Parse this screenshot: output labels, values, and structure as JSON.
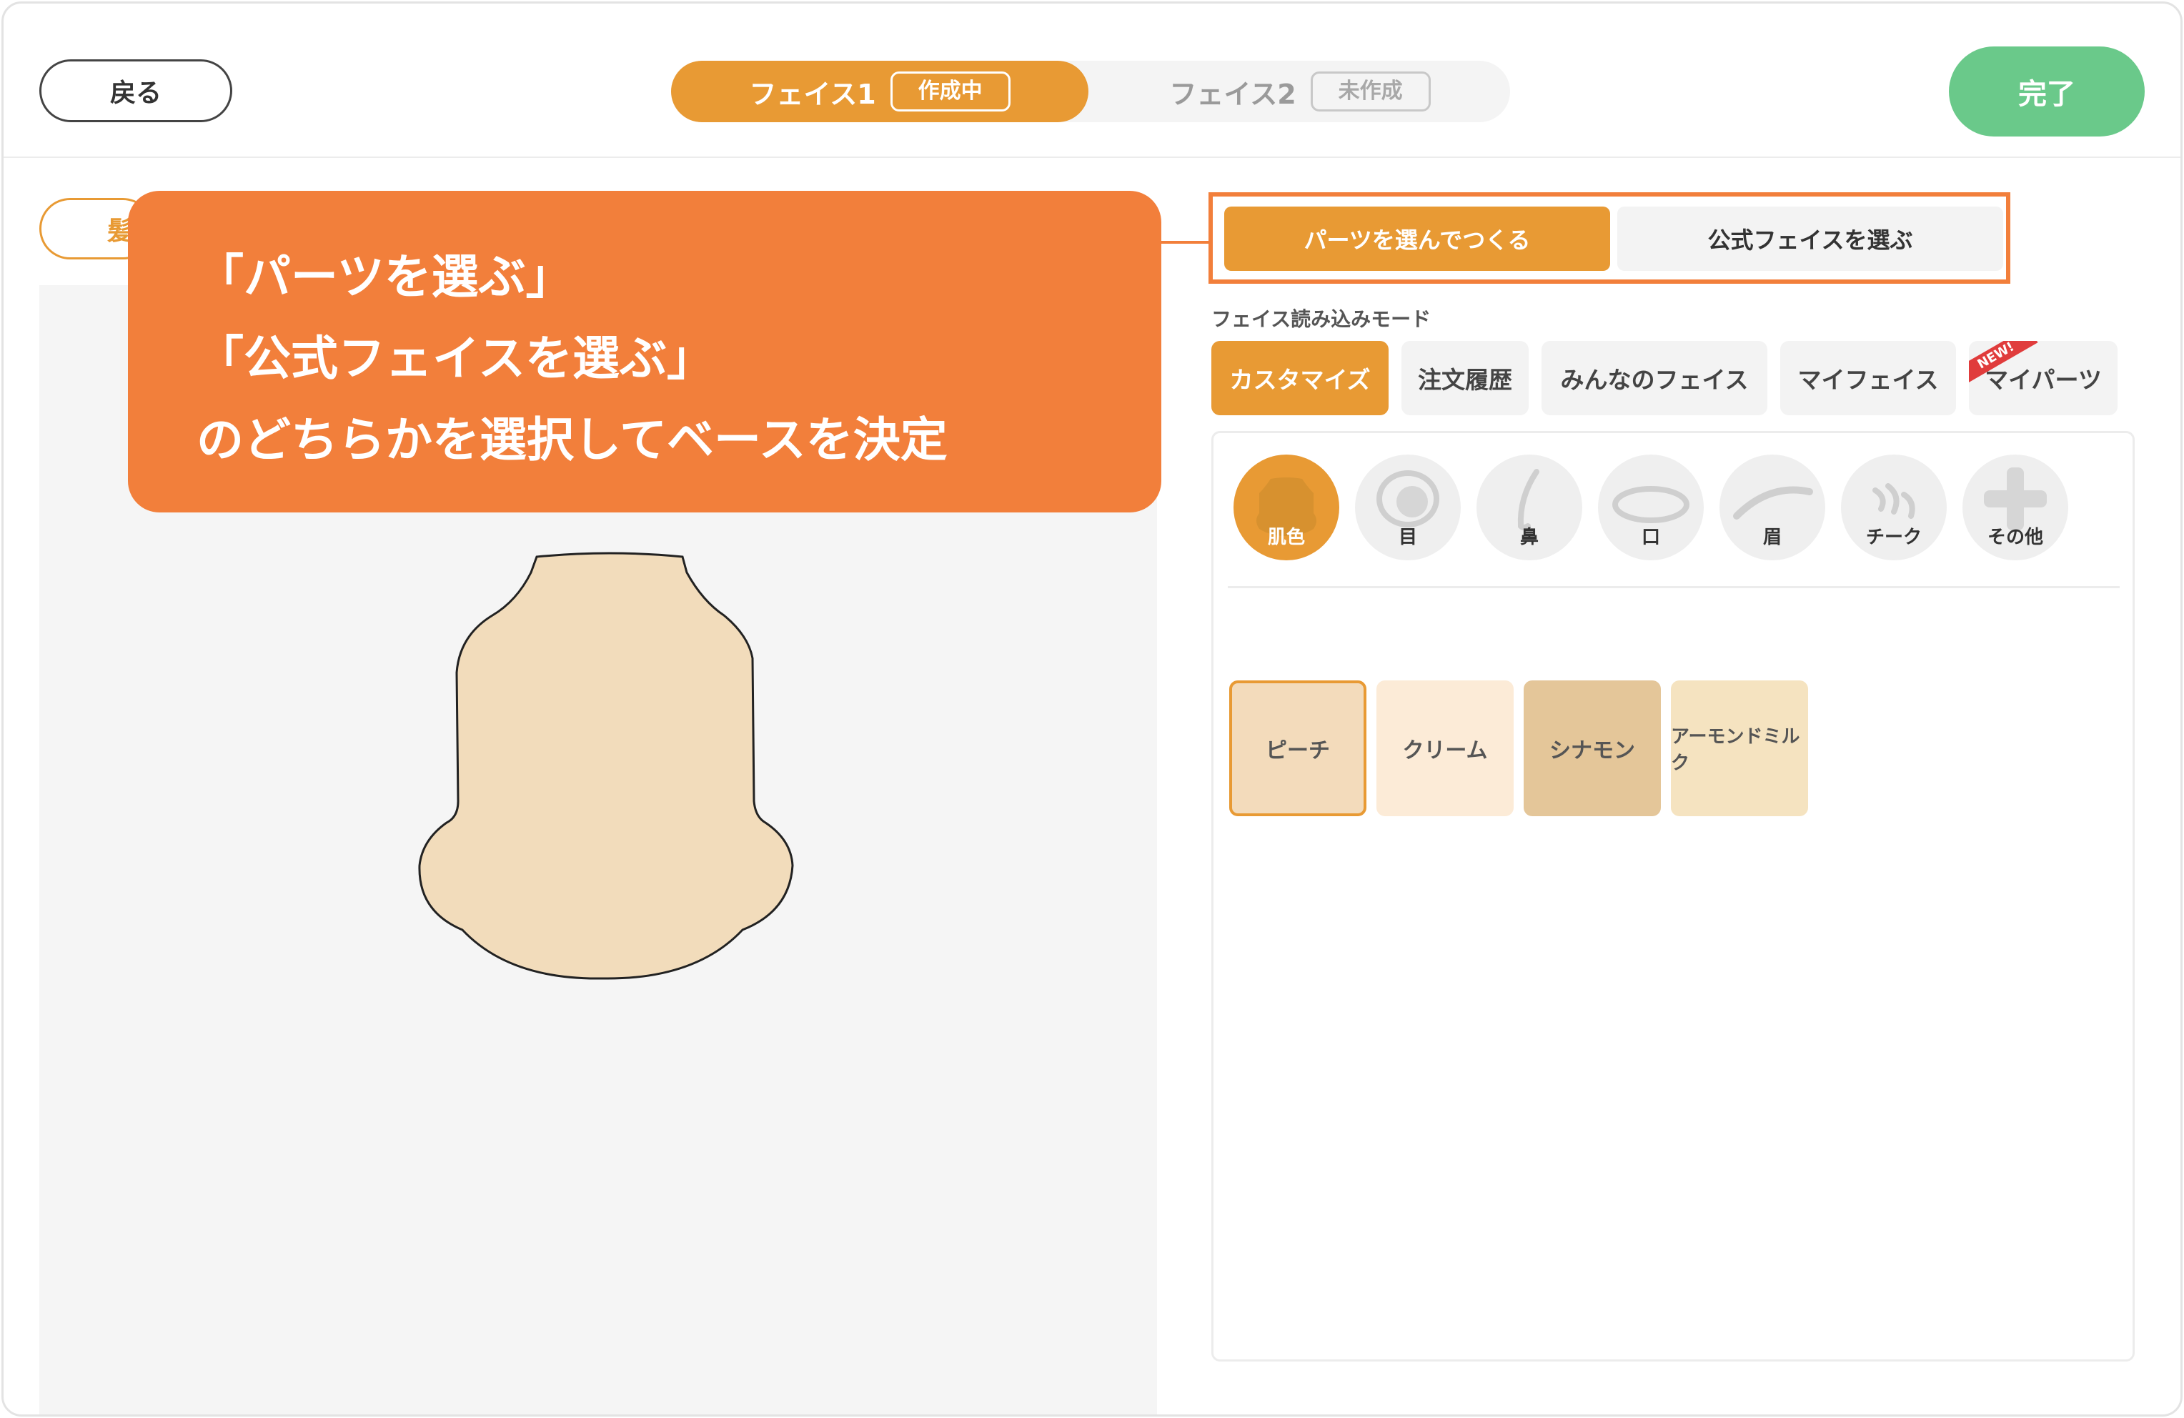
{
  "header": {
    "back_label": "戻る",
    "done_label": "完了",
    "face_tabs": [
      {
        "label": "フェイス1",
        "status": "作成中"
      },
      {
        "label": "フェイス2",
        "status": "未作成"
      }
    ]
  },
  "left": {
    "hair_tab_label": "髪"
  },
  "callout": {
    "lines": [
      "「パーツを選ぶ」",
      "「公式フェイスを選ぶ」",
      "のどちらかを選択してベースを決定"
    ]
  },
  "mode_toggle": {
    "options": [
      "パーツを選んでつくる",
      "公式フェイスを選ぶ"
    ],
    "selected": "パーツを選んでつくる"
  },
  "load_mode": {
    "label": "フェイス読み込みモード",
    "tabs": [
      "カスタマイズ",
      "注文履歴",
      "みんなのフェイス",
      "マイフェイス",
      "マイパーツ"
    ],
    "selected": "カスタマイズ",
    "new_badge": "NEW!"
  },
  "parts": {
    "categories": [
      "肌色",
      "目",
      "鼻",
      "口",
      "眉",
      "チーク",
      "その他"
    ],
    "selected": "肌色"
  },
  "skin_colors": {
    "options": [
      {
        "label": "ピーチ",
        "color": "#f3dbbb"
      },
      {
        "label": "クリーム",
        "color": "#fcebd7"
      },
      {
        "label": "シナモン",
        "color": "#e4c699"
      },
      {
        "label": "アーモンドミルク",
        "color": "#f5e3c0"
      }
    ],
    "selected": "ピーチ"
  },
  "colors": {
    "accent": "#e89a34",
    "callout": "#f27f3b",
    "done": "#6ac98a",
    "face_skin": "#f2dcbb"
  }
}
